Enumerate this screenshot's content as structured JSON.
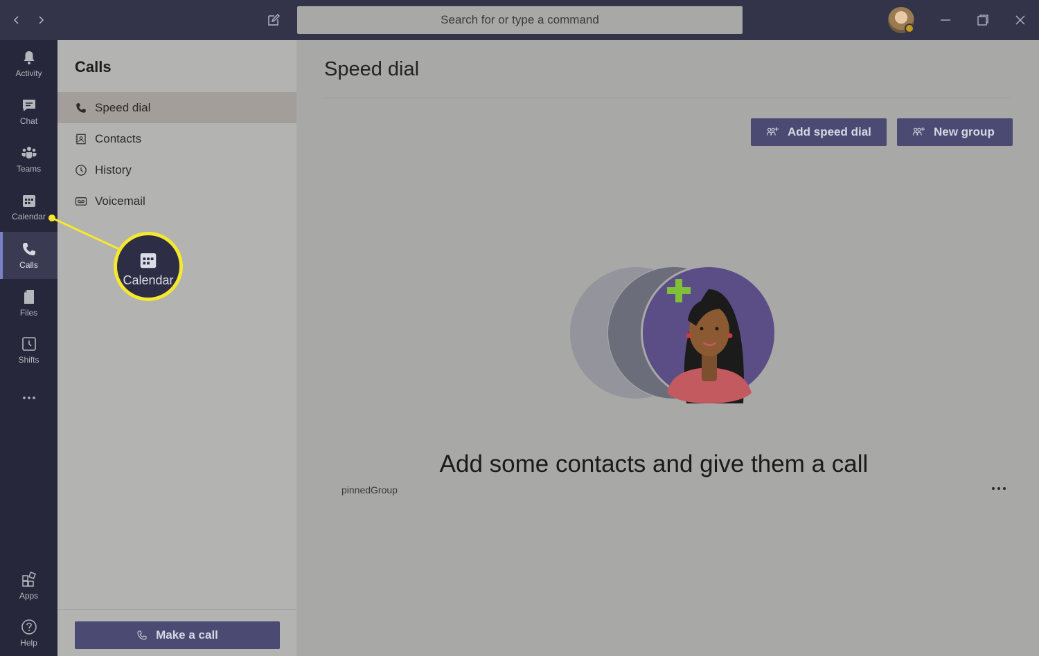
{
  "titlebar": {
    "search_placeholder": "Search for or type a command"
  },
  "rail": {
    "items": [
      {
        "label": "Activity",
        "icon": "bell-icon"
      },
      {
        "label": "Chat",
        "icon": "chat-icon"
      },
      {
        "label": "Teams",
        "icon": "teams-icon"
      },
      {
        "label": "Calendar",
        "icon": "calendar-icon"
      },
      {
        "label": "Calls",
        "icon": "phone-icon",
        "active": true
      },
      {
        "label": "Files",
        "icon": "file-icon"
      },
      {
        "label": "Shifts",
        "icon": "clock-icon"
      }
    ],
    "bottom": [
      {
        "label": "Apps",
        "icon": "apps-icon"
      },
      {
        "label": "Help",
        "icon": "help-icon"
      }
    ]
  },
  "panel": {
    "title": "Calls",
    "items": [
      {
        "label": "Speed dial",
        "icon": "phone-icon",
        "selected": true
      },
      {
        "label": "Contacts",
        "icon": "contacts-icon"
      },
      {
        "label": "History",
        "icon": "history-icon"
      },
      {
        "label": "Voicemail",
        "icon": "voicemail-icon"
      }
    ],
    "make_call_label": "Make a call"
  },
  "main": {
    "title": "Speed dial",
    "add_speed_dial_label": "Add speed dial",
    "new_group_label": "New group",
    "empty_message": "Add some contacts and give them a call",
    "pinned_label": "pinnedGroup"
  },
  "callout": {
    "label": "Calendar",
    "highlight_color": "#f6e82f"
  },
  "colors": {
    "titlebar": "#33344a",
    "rail": "#26273a",
    "accent_button": "#4a4a72",
    "rail_active_indicator": "#7b7fc4"
  }
}
